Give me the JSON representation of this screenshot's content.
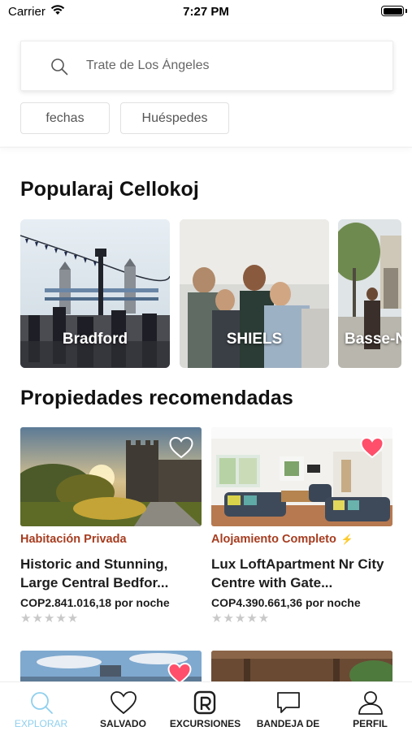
{
  "status_bar": {
    "carrier": "Carrier",
    "time": "7:27 PM",
    "icons": [
      "wifi-icon",
      "battery-icon"
    ]
  },
  "search": {
    "placeholder": "Trate de Los Ángeles",
    "icon": "search-icon"
  },
  "filters": {
    "dates_label": "fechas",
    "guests_label": "Huéspedes"
  },
  "popular": {
    "title": "Popularaj Cellokoj",
    "destinations": [
      {
        "label": "Bradford"
      },
      {
        "label": "SHIELS"
      },
      {
        "label": "Basse-N"
      }
    ]
  },
  "recommended": {
    "title": "Propiedades recomendadas",
    "listings": [
      {
        "type": "Habitación Privada",
        "name": "Historic and Stunning, Large Central Bedfor...",
        "price": "COP2.841.016,18 por noche",
        "rating_stars": "★★★★★",
        "rating_value": 0,
        "favorited": false
      },
      {
        "type": "Alojamiento Completo",
        "type_badge_icon": "lightning-bolt-icon",
        "name": "Lux LoftApartment Nr City Centre with Gate...",
        "price": "COP4.390.661,36 por noche",
        "rating_stars": "★★★★★",
        "rating_value": 0,
        "favorited": true
      }
    ],
    "peek_favorited": [
      true,
      false
    ]
  },
  "tab_bar": {
    "tabs": [
      {
        "label": "EXPLORAR",
        "icon": "search-icon",
        "active": true
      },
      {
        "label": "SALVADO",
        "icon": "heart-icon",
        "active": false
      },
      {
        "label": "EXCURSIONES",
        "icon": "trips-logo-icon",
        "active": false
      },
      {
        "label": "BANDEJA DE",
        "icon": "chat-bubble-icon",
        "active": false
      },
      {
        "label": "PERFIL",
        "icon": "person-icon",
        "active": false
      }
    ]
  },
  "colors": {
    "accent_type": "#a73c1f",
    "heart_active": "#ff4f6a",
    "tab_active": "#8fd0ee",
    "bolt": "#f2c53d",
    "stars_inactive": "#c9c9c9"
  }
}
